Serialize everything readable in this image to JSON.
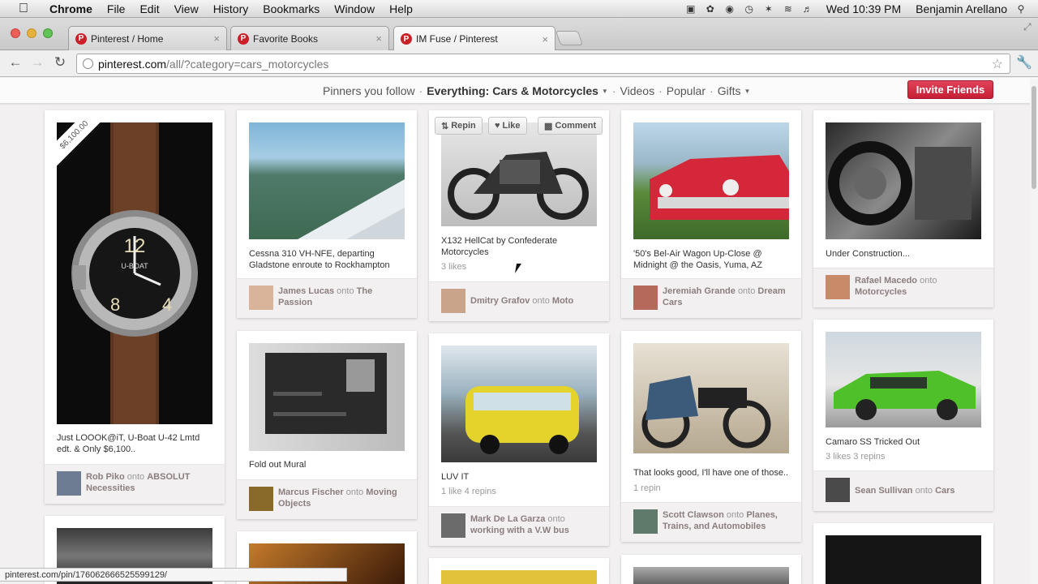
{
  "menubar": {
    "app": "Chrome",
    "items": [
      "File",
      "Edit",
      "View",
      "History",
      "Bookmarks",
      "Window",
      "Help"
    ],
    "clock": "Wed 10:39 PM",
    "user": "Benjamin Arellano"
  },
  "tabs": [
    {
      "label": "Pinterest / Home",
      "icon": "pinterest-icon"
    },
    {
      "label": "Favorite Books",
      "icon": "pinterest-icon"
    },
    {
      "label": "IM Fuse / Pinterest",
      "icon": "pinterest-icon"
    }
  ],
  "address": {
    "host": "pinterest.com",
    "path": "/all/?category=cars_motorcycles"
  },
  "catnav": {
    "following": "Pinners you follow",
    "everything": "Everything:",
    "category": "Cars & Motorcycles",
    "videos": "Videos",
    "popular": "Popular",
    "gifts": "Gifts",
    "sep": "·"
  },
  "invite": "Invite Friends",
  "hover_actions": {
    "repin": "Repin",
    "like": "Like",
    "comment": "Comment"
  },
  "pins": [
    {
      "caption": "Just LOOOK@iT, U-Boat U-42 Lmtd edt. & Only $6,100..",
      "price": "$6,100.00",
      "user": "Rob Piko",
      "onto": "onto",
      "board": "ABSOLUT Necessities",
      "stats": ""
    },
    {
      "caption": "Cessna 310 VH-NFE, departing Gladstone enroute to Rockhampton",
      "user": "James Lucas",
      "onto": "onto",
      "board": "The Passion",
      "stats": ""
    },
    {
      "caption": "X132 HellCat by Confederate Motorcycles",
      "user": "Dmitry Grafov",
      "onto": "onto",
      "board": "Moto",
      "stats": "3 likes"
    },
    {
      "caption": "'50's Bel-Air Wagon Up-Close @ Midnight @ the Oasis, Yuma, AZ",
      "user": "Jeremiah Grande",
      "onto": "onto",
      "board": "Dream Cars",
      "stats": ""
    },
    {
      "caption": "Under Construction...",
      "user": "Rafael Macedo",
      "onto": "onto",
      "board": "Motorcycles",
      "stats": ""
    },
    {
      "caption": "Fold out Mural",
      "user": "Marcus Fischer",
      "onto": "onto",
      "board": "Moving Objects",
      "stats": ""
    },
    {
      "caption": "LUV IT",
      "user": "Mark De La Garza",
      "onto": "onto",
      "board": "working with a V.W bus",
      "stats": "1 like  4 repins"
    },
    {
      "caption": "That looks good, I'll have one of those..",
      "user": "Scott Clawson",
      "onto": "onto",
      "board": "Planes, Trains, and Automobiles",
      "stats": "1 repin"
    },
    {
      "caption": "Camaro SS Tricked Out",
      "user": "Sean Sullivan",
      "onto": "onto",
      "board": "Cars",
      "stats": "3 likes  3 repins"
    }
  ],
  "statusbar": "pinterest.com/pin/176062666525599129/",
  "colors": {
    "accent": "#cb2027",
    "board": "#8c7e7e"
  }
}
